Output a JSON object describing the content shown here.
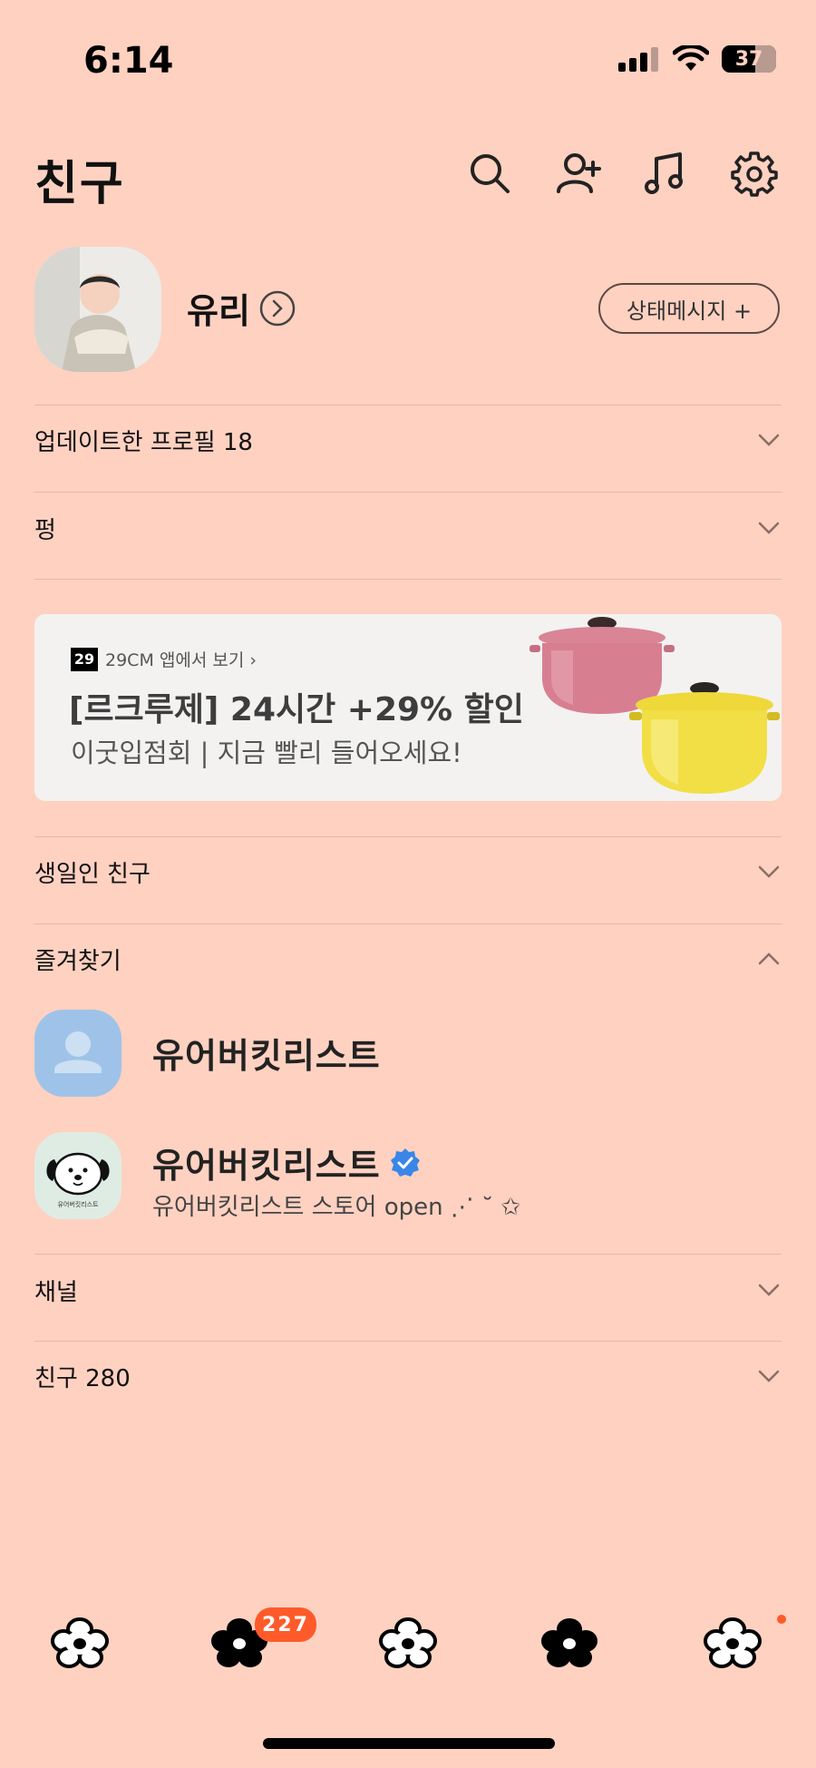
{
  "status_bar": {
    "time": "6:14",
    "battery": "37"
  },
  "header": {
    "title": "친구",
    "icons": [
      "search-icon",
      "add-friend-icon",
      "music-icon",
      "settings-icon"
    ]
  },
  "profile": {
    "name": "유리",
    "status_button_label": "상태메시지 +"
  },
  "sections": {
    "updated_profiles": "업데이트한 프로필 18",
    "pung": "펑",
    "birthday": "생일인 친구",
    "favorites": "즐겨찾기",
    "channel": "채널",
    "friends": "친구 280"
  },
  "ad": {
    "logo": "29",
    "source": "29CM 앱에서 보기 ›",
    "title": "[르크루제] 24시간 +29% 할인",
    "subtitle": "이굿입점회 | 지금 빨리 들어오세요!"
  },
  "favorites": [
    {
      "name": "유어버킷리스트",
      "status": ""
    },
    {
      "name": "유어버킷리스트",
      "status": "유어버킷리스트 스토어 open ⋰ ˘ ✩",
      "avatar_text": "유어버킷리스트",
      "verified": true
    }
  ],
  "bottom_nav": {
    "badge": "227"
  },
  "colors": {
    "background": "#FFD1C1",
    "badge": "#ff5a2a",
    "verified": "#3a86e8"
  }
}
